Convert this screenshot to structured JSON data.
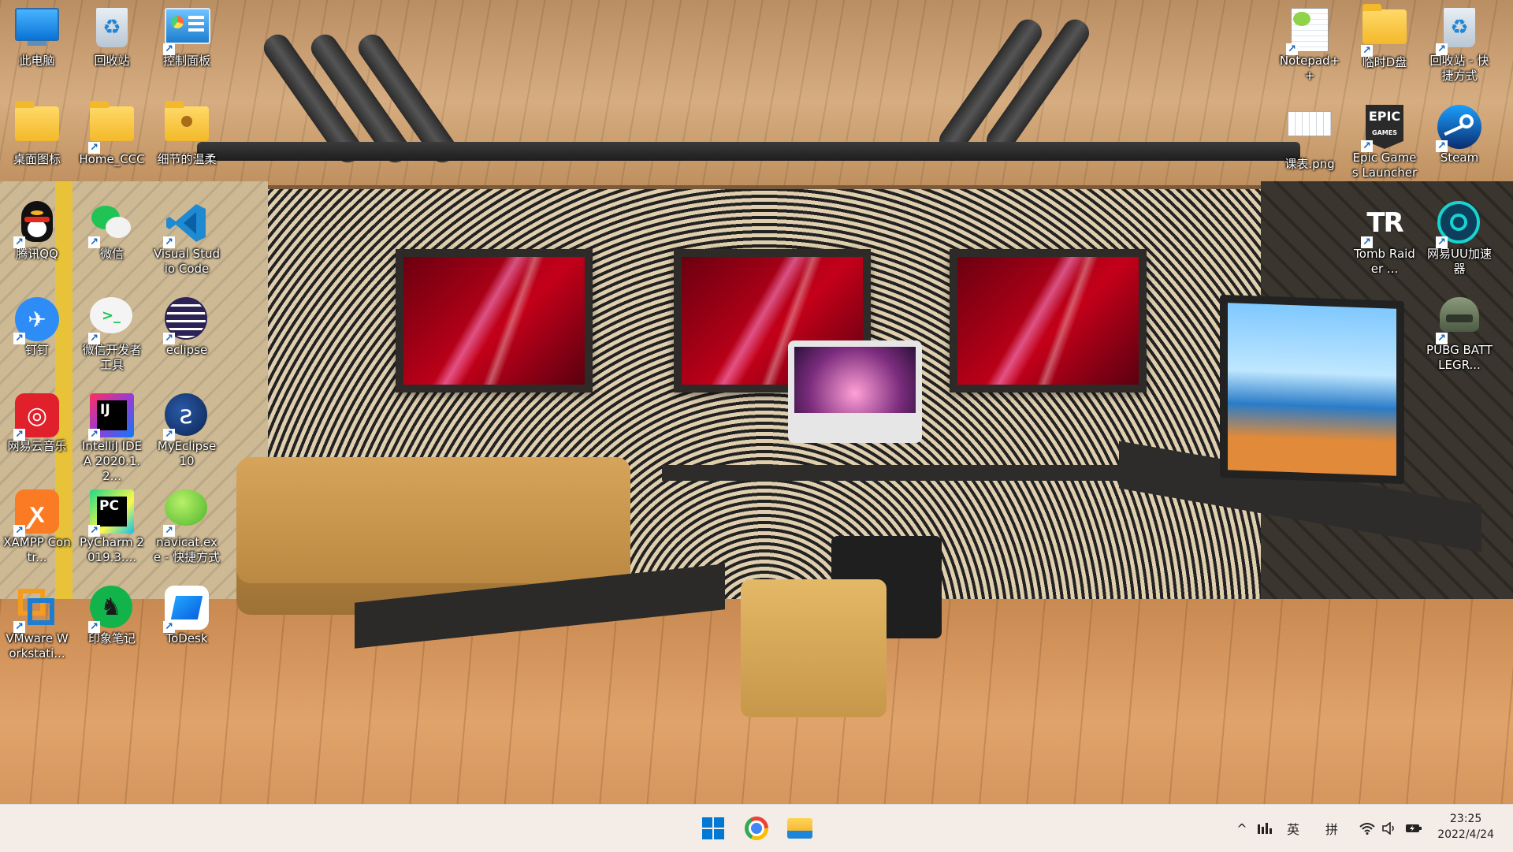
{
  "desktop": {
    "left_icons": [
      {
        "id": "this-pc",
        "label": "此电脑",
        "icon": "monitor-icon",
        "shortcut": false
      },
      {
        "id": "recycle-bin",
        "label": "回收站",
        "icon": "recycle-bin-icon",
        "shortcut": false
      },
      {
        "id": "control-panel",
        "label": "控制面板",
        "icon": "control-panel-icon",
        "shortcut": true
      },
      {
        "id": "desktop-icons-folder",
        "label": "桌面图标",
        "icon": "folder-icon",
        "shortcut": false
      },
      {
        "id": "home-ccc",
        "label": "Home_CCC",
        "icon": "folder-icon",
        "shortcut": true
      },
      {
        "id": "gentle-details",
        "label": "细节的温柔",
        "icon": "user-folder-icon",
        "shortcut": false
      },
      {
        "id": "tencent-qq",
        "label": "腾讯QQ",
        "icon": "qq-penguin-icon",
        "shortcut": true
      },
      {
        "id": "wechat",
        "label": "微信",
        "icon": "wechat-icon",
        "shortcut": true
      },
      {
        "id": "vscode",
        "label": "Visual Studio Code",
        "icon": "vscode-icon",
        "shortcut": true
      },
      {
        "id": "dingtalk",
        "label": "钉钉",
        "icon": "dingtalk-icon",
        "shortcut": true
      },
      {
        "id": "wechat-devtools",
        "label": "微信开发者工具",
        "icon": "wechat-devtools-icon",
        "shortcut": true
      },
      {
        "id": "eclipse",
        "label": "eclipse",
        "icon": "eclipse-icon",
        "shortcut": true
      },
      {
        "id": "netease-music",
        "label": "网易云音乐",
        "icon": "netease-music-icon",
        "shortcut": true
      },
      {
        "id": "intellij",
        "label": "IntelliJ IDEA 2020.1.2...",
        "icon": "intellij-icon",
        "shortcut": true
      },
      {
        "id": "myeclipse",
        "label": "MyEclipse 10",
        "icon": "myeclipse-icon",
        "shortcut": true
      },
      {
        "id": "xampp",
        "label": "XAMPP Contr...",
        "icon": "xampp-icon",
        "shortcut": true
      },
      {
        "id": "pycharm",
        "label": "PyCharm 2019.3....",
        "icon": "pycharm-icon",
        "shortcut": true
      },
      {
        "id": "navicat",
        "label": "navicat.exe - 快捷方式",
        "icon": "navicat-icon",
        "shortcut": true
      },
      {
        "id": "vmware",
        "label": "VMware Workstati...",
        "icon": "vmware-icon",
        "shortcut": true
      },
      {
        "id": "evernote",
        "label": "印象笔记",
        "icon": "evernote-icon",
        "shortcut": true
      },
      {
        "id": "todesk",
        "label": "ToDesk",
        "icon": "todesk-icon",
        "shortcut": true
      }
    ],
    "right_icons": [
      {
        "id": "notepadpp",
        "label": "Notepad++",
        "icon": "notepadpp-icon",
        "shortcut": true
      },
      {
        "id": "temp-d",
        "label": "临时D盘",
        "icon": "folder-icon",
        "shortcut": true
      },
      {
        "id": "recycle-shortcut",
        "label": "回收站 - 快捷方式",
        "icon": "recycle-bin-icon",
        "shortcut": true
      },
      {
        "id": "schedule-png",
        "label": "课表.png",
        "icon": "image-file-icon",
        "shortcut": false
      },
      {
        "id": "epic",
        "label": "Epic Games Launcher",
        "icon": "epic-games-icon",
        "shortcut": true
      },
      {
        "id": "steam",
        "label": "Steam",
        "icon": "steam-icon",
        "shortcut": true
      },
      {
        "id": "tomb-raider",
        "label": "Tomb Raider ...",
        "icon": "tomb-raider-icon",
        "shortcut": true
      },
      {
        "id": "netease-uu",
        "label": "网易UU加速器",
        "icon": "netease-uu-icon",
        "shortcut": true
      },
      {
        "id": "pubg",
        "label": "PUBG BATTLEGR...",
        "icon": "pubg-helmet-icon",
        "shortcut": true
      }
    ]
  },
  "taskbar": {
    "pinned": [
      {
        "id": "start",
        "icon": "windows-start-icon"
      },
      {
        "id": "chrome",
        "icon": "chrome-icon"
      },
      {
        "id": "explorer",
        "icon": "file-explorer-icon"
      }
    ],
    "tray": {
      "chevron": "^",
      "input_mode": "英",
      "ime": "拼",
      "time": "23:25",
      "date": "2022/4/24"
    }
  },
  "colors": {
    "taskbar_bg": "#f3ece7",
    "windows_blue": "#0078d4",
    "label_text": "#ffffff"
  }
}
